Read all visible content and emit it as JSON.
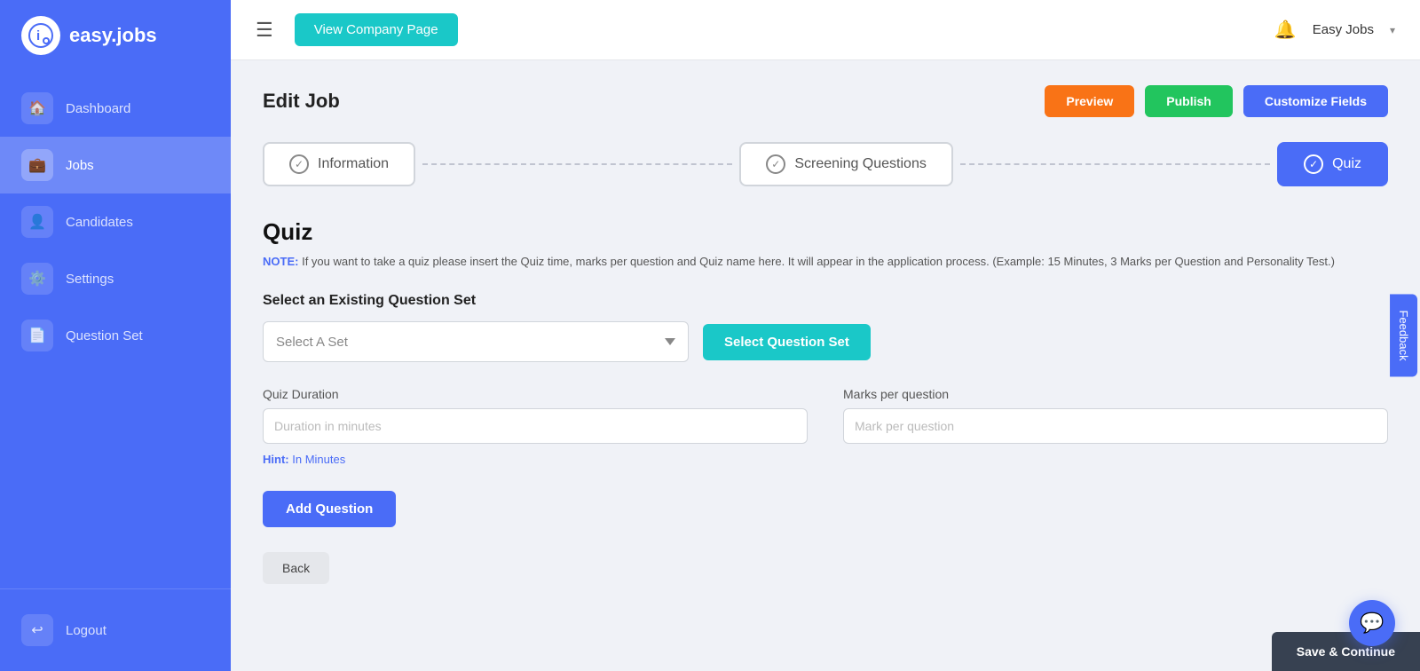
{
  "sidebar": {
    "logo": {
      "icon": "i",
      "text": "easy.jobs"
    },
    "items": [
      {
        "id": "dashboard",
        "label": "Dashboard",
        "icon": "🏠",
        "active": false
      },
      {
        "id": "jobs",
        "label": "Jobs",
        "icon": "💼",
        "active": true
      },
      {
        "id": "candidates",
        "label": "Candidates",
        "icon": "👤",
        "active": false
      },
      {
        "id": "settings",
        "label": "Settings",
        "icon": "⚙️",
        "active": false
      },
      {
        "id": "question-set",
        "label": "Question Set",
        "icon": "📄",
        "active": false
      }
    ],
    "logout": {
      "label": "Logout",
      "icon": "🚪"
    }
  },
  "topbar": {
    "view_company_btn": "View Company Page",
    "user_name": "Easy Jobs",
    "chevron": "▾"
  },
  "edit_job": {
    "title": "Edit Job",
    "buttons": {
      "preview": "Preview",
      "publish": "Publish",
      "customize": "Customize Fields"
    }
  },
  "steps": [
    {
      "id": "information",
      "label": "Information",
      "active": false,
      "check": "✓"
    },
    {
      "id": "screening",
      "label": "Screening Questions",
      "active": false,
      "check": "✓"
    },
    {
      "id": "quiz",
      "label": "Quiz",
      "active": true,
      "check": "✓"
    }
  ],
  "quiz": {
    "title": "Quiz",
    "note_label": "NOTE:",
    "note_text": " If you want to take a quiz please insert the Quiz time, marks per question and Quiz name here. It will appear in the application process. (Example: 15 Minutes, 3 Marks per Question and Personality Test.)",
    "select_section_label": "Select an Existing Question Set",
    "select_placeholder": "Select A Set",
    "select_btn": "Select Question Set",
    "duration_label": "Quiz Duration",
    "duration_placeholder": "Duration in minutes",
    "marks_label": "Marks per question",
    "marks_placeholder": "Mark per question",
    "hint_label": "Hint:",
    "hint_text": " In Minutes",
    "add_question_btn": "Add Question",
    "back_btn": "Back",
    "save_continue_btn": "Save & Continue"
  },
  "feedback_btn": "Feedback",
  "chat_icon": "💬"
}
